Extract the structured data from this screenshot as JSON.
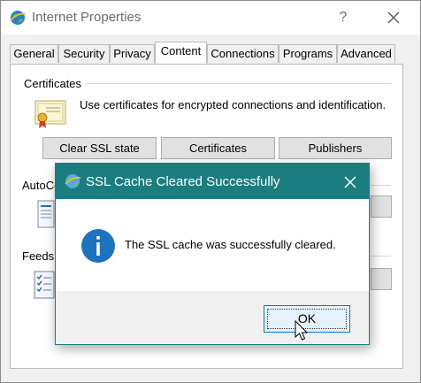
{
  "window": {
    "title": "Internet Properties",
    "help_glyph": "?"
  },
  "tabs": [
    {
      "label": "General"
    },
    {
      "label": "Security"
    },
    {
      "label": "Privacy"
    },
    {
      "label": "Content",
      "active": true
    },
    {
      "label": "Connections"
    },
    {
      "label": "Programs"
    },
    {
      "label": "Advanced"
    }
  ],
  "content": {
    "certificates": {
      "heading": "Certificates",
      "description": "Use certificates for encrypted connections and identification.",
      "buttons": {
        "clear_ssl": "Clear SSL state",
        "certificates": "Certificates",
        "publishers": "Publishers"
      }
    },
    "autocomplete": {
      "heading_visible": "AutoCo"
    },
    "feeds": {
      "heading": "Feeds"
    }
  },
  "dialog": {
    "title": "SSL Cache Cleared Successfully",
    "message": "The SSL cache was successfully cleared.",
    "ok_label": "OK"
  },
  "colors": {
    "dialog_titlebar": "#1b7d7f",
    "info_icon": "#1e73be",
    "ok_border": "#0078d7"
  }
}
